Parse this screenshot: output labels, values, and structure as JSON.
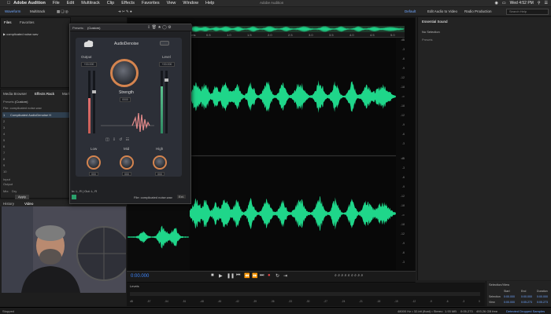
{
  "menubar": {
    "app": "Adobe Audition",
    "items": [
      "File",
      "Edit",
      "Multitrack",
      "Clip",
      "Effects",
      "Favorites",
      "View",
      "Window",
      "Help"
    ],
    "window_title": "Adobe Audition",
    "clock": "Wed 4:52 PM"
  },
  "toolbar": {
    "waveform": "Waveform",
    "multitrack": "Multitrack",
    "default": "Default",
    "edit_audio_video": "Edit Audio to Video",
    "radio": "Radio Production",
    "search": "Search Help"
  },
  "files_panel": {
    "tab_files": "Files",
    "tab_favorites": "Favorites",
    "file": "complicated noise.wav"
  },
  "effects_rack": {
    "tab_media": "Media Browser",
    "tab_effects": "Effects Rack",
    "tab_markers": "Mark",
    "presets_label": "Presets:",
    "presets_value": "(Custom)",
    "file_label": "File: complicated noise.wav",
    "effect1": "Complicated AudioDenoise H",
    "slots": [
      "1",
      "2",
      "3",
      "4",
      "5",
      "6",
      "7",
      "8",
      "9",
      "10"
    ],
    "input": "Input",
    "output": "Output",
    "mix_label": "Mix:",
    "apply": "Apply",
    "dry": "Dry"
  },
  "plugin": {
    "presets_label": "Presets:",
    "presets_value": "(Custom)",
    "title": "AudioDenoise",
    "output_label": "Output",
    "level_label": "Level",
    "strength_label": "Strength",
    "strength_value": "0000",
    "output_value": "+00.000",
    "level_value": "+00.000",
    "low_label": "Low",
    "mid_label": "Mid",
    "high_label": "High",
    "low_value": "000",
    "mid_value": "000",
    "high_value": "000",
    "footer_file": "File: complicated noise.wav",
    "footer_btn": "Ext.",
    "io_label": "In: L, R | Out: L, R"
  },
  "video_panel": {
    "tab_history": "History",
    "tab_video": "Video"
  },
  "waveform": {
    "tab_editor": "Editor: complicated noise.wav",
    "hud_value": "+0 dB",
    "ruler": [
      "hms",
      "0.5",
      "1.0",
      "1.5",
      "2.0",
      "2.5",
      "3.0",
      "3.5",
      "4.0",
      "4.5",
      "5.0"
    ],
    "db_top": [
      "dB",
      "-3",
      "-6",
      "-9",
      "-12",
      "-18",
      "-∞",
      "-18",
      "-12",
      "-9",
      "-6",
      "-3"
    ],
    "db_bottom": [
      "dB",
      "-3",
      "-6",
      "-9",
      "-12",
      "-18",
      "-∞",
      "-18",
      "-12",
      "-9",
      "-6",
      "-3"
    ],
    "timecode": "0:00.000"
  },
  "right_panel": {
    "tab": "Essential Sound",
    "no_selection": "No Selection",
    "sub": "Presets"
  },
  "selection_view": {
    "title": "Selection/View",
    "col_start": "Start",
    "col_end": "End",
    "col_duration": "Duration",
    "row_selection": "Selection",
    "row_view": "View",
    "sel_start": "0:00.000",
    "sel_end": "0:00.000",
    "sel_dur": "0:00.000",
    "view_start": "0:00.000",
    "view_end": "0:05.273",
    "view_dur": "0:05.273"
  },
  "levels": {
    "title": "Levels",
    "scale": [
      "dB",
      "-57",
      "-54",
      "-51",
      "-48",
      "-45",
      "-42",
      "-39",
      "-36",
      "-33",
      "-30",
      "-27",
      "-24",
      "-21",
      "-18",
      "-15",
      "-12",
      "-9",
      "-6",
      "-3",
      "0"
    ]
  },
  "statusbar": {
    "left": "Stopped",
    "info": "48000 Hz • 32-bit (float) • Stereo",
    "size": "1.93 MB",
    "dur": "0:05.273",
    "free": "493.26 GB free",
    "dropped": "Detected Dropped Samples"
  },
  "colors": {
    "waveform": "#1fd68a",
    "accent_blue": "#3d86ff",
    "knob_orange": "#d4844f"
  }
}
